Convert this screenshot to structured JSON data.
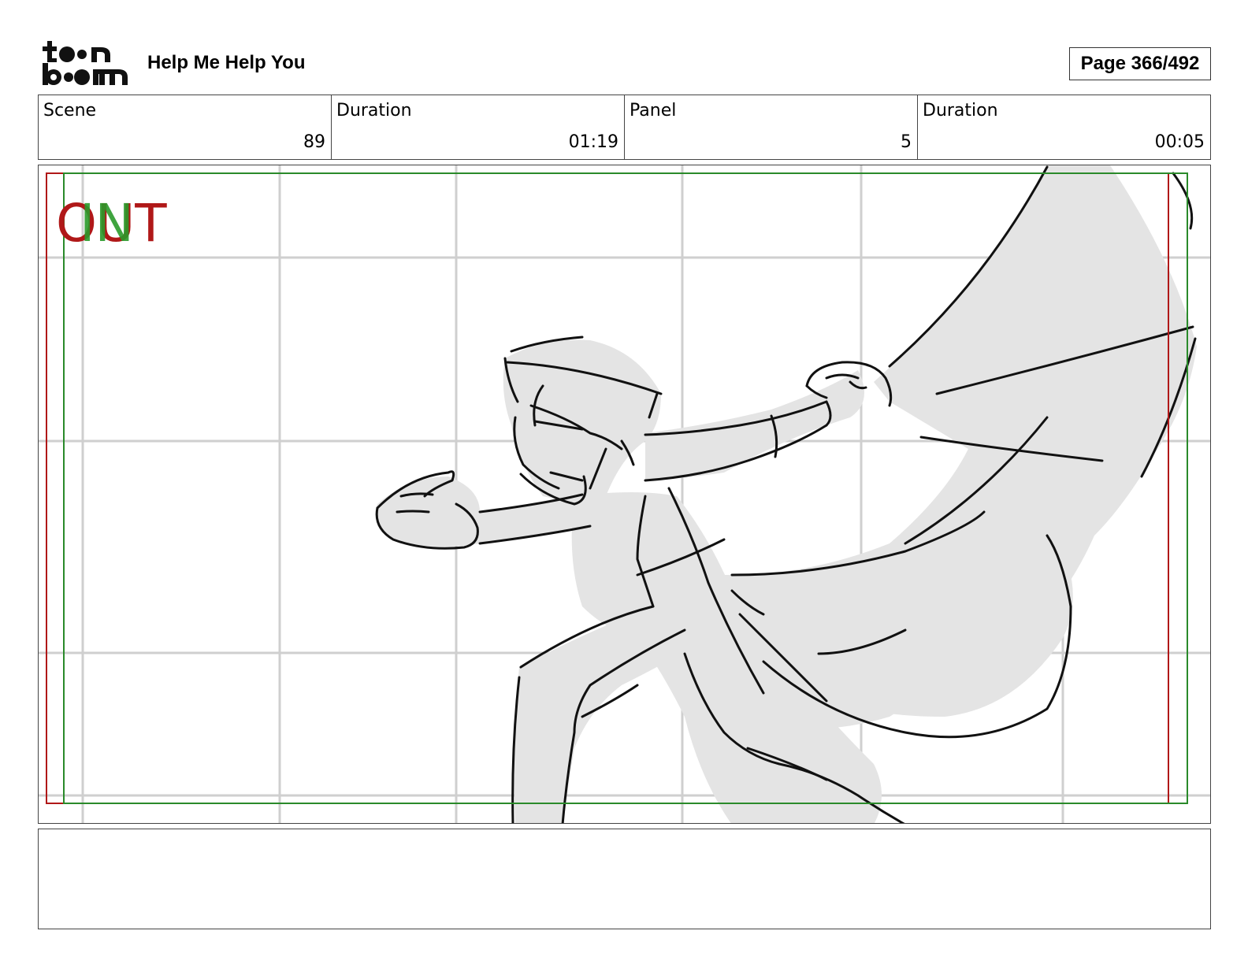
{
  "header": {
    "logo_text": "toonboom",
    "project_title": "Help Me Help You",
    "page_label": "Page 366/492"
  },
  "info": [
    {
      "label": "Scene",
      "value": "89"
    },
    {
      "label": "Duration",
      "value": "01:19"
    },
    {
      "label": "Panel",
      "value": "5"
    },
    {
      "label": "Duration",
      "value": "00:05"
    }
  ],
  "panel": {
    "marker_out": "OUT",
    "marker_in": "IN",
    "colors": {
      "out_frame": "#b01818",
      "in_frame": "#2a8a2a",
      "grid": "#cfcfcf",
      "fill": "#e4e4e4",
      "stroke": "#111111"
    }
  },
  "notes": {
    "text": ""
  }
}
